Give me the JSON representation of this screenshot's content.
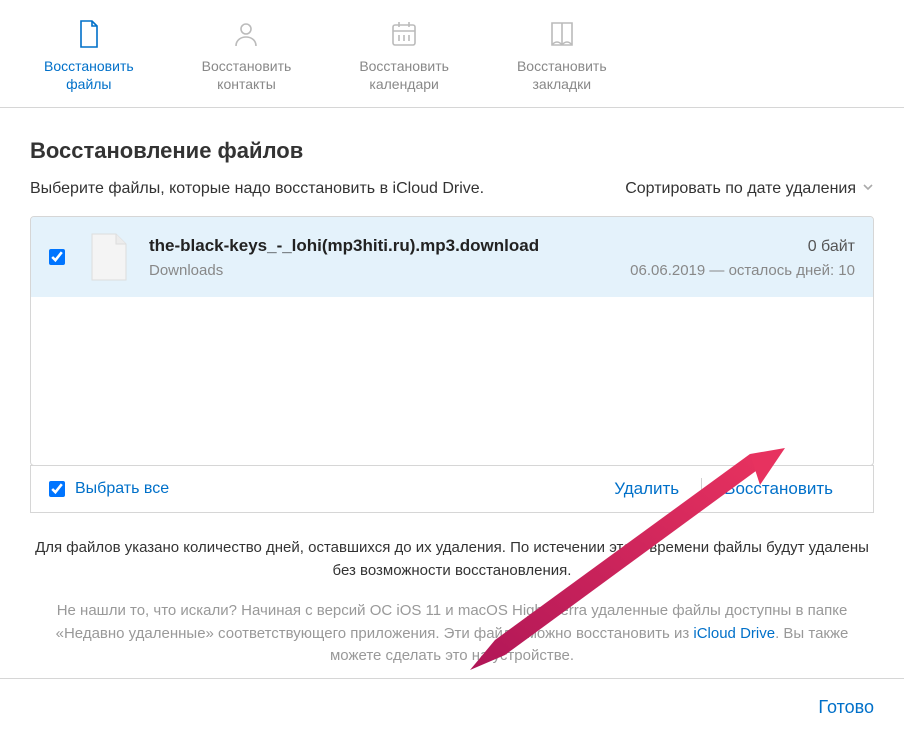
{
  "tabs": [
    {
      "label": "Восстановить\nфайлы",
      "icon": "file"
    },
    {
      "label": "Восстановить\nконтакты",
      "icon": "contact"
    },
    {
      "label": "Восстановить\nкалендари",
      "icon": "calendar"
    },
    {
      "label": "Восстановить\nзакладки",
      "icon": "bookmark"
    }
  ],
  "section": {
    "title": "Восстановление файлов",
    "description": "Выберите файлы, которые надо восстановить в iCloud Drive.",
    "sort_label": "Сортировать по дате удаления"
  },
  "files": [
    {
      "name": "the-black-keys_-_lohi(mp3hiti.ru).mp3.download",
      "size": "0 байт",
      "folder": "Downloads",
      "date_info": "06.06.2019 — осталось дней: 10",
      "checked": true
    }
  ],
  "actions": {
    "select_all": "Выбрать все",
    "delete": "Удалить",
    "restore": "Восстановить"
  },
  "footer": {
    "p1": "Для файлов указано количество дней, оставшихся до их удаления. По истечении этого времени файлы будут удалены без возможности восстановления.",
    "p2_a": "Не нашли то, что искали? Начиная с версий ОС iOS 11 и macOS High Sierra удаленные файлы доступны в папке «Недавно удаленные» соответствующего приложения. Эти файлы можно восстановить из ",
    "p2_link": "iCloud Drive",
    "p2_b": ". Вы также можете сделать это на устройстве."
  },
  "done": "Готово"
}
